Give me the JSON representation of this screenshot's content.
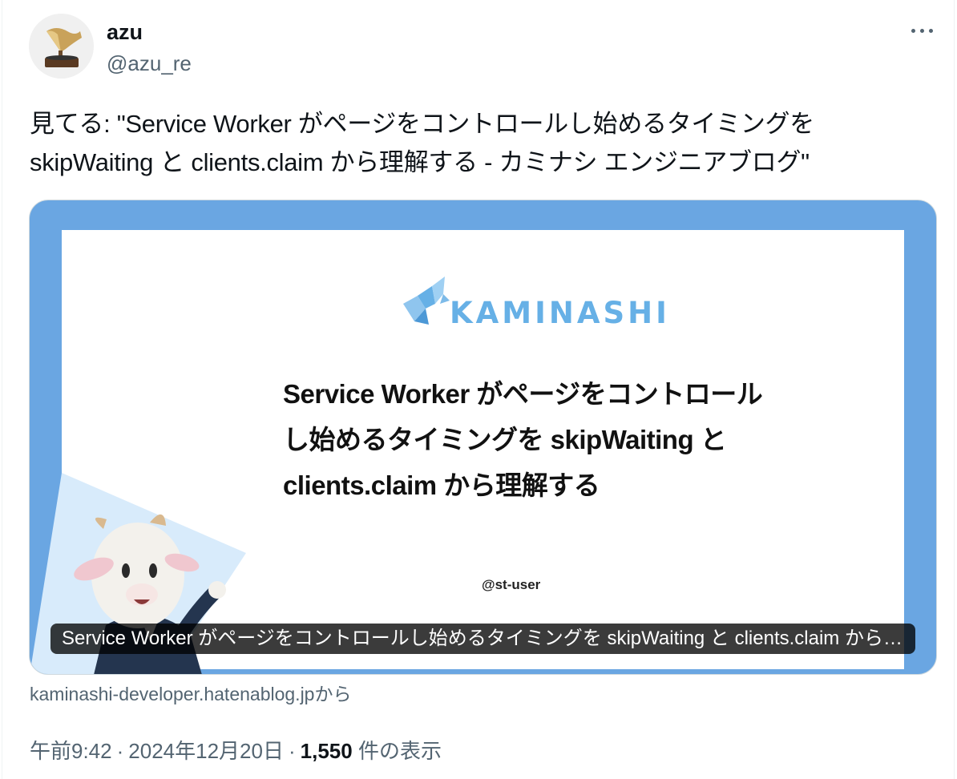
{
  "author": {
    "display_name": "azu",
    "handle": "@azu_re"
  },
  "tweet": {
    "text": "見てる: \"Service Worker がページをコントロールし始めるタイミングを skipWaiting と clients.claim から理解する - カミナシ エンジニアブログ\""
  },
  "card": {
    "logo_text": "KAMINASHI",
    "slide_title": "Service Worker がページをコントロールし始めるタイミングを skipWaiting と clients.claim から理解する",
    "slide_author": "@st-user",
    "caption": "Service Worker がページをコントロールし始めるタイミングを skipWaiting と clients.claim から理解する - カミナシ エンジニアブログ",
    "background_color": "#6aa6e2",
    "source": "kaminashi-developer.hatenablog.jpから"
  },
  "meta": {
    "time": "午前9:42",
    "date": "2024年12月20日",
    "views_count": "1,550",
    "views_label": "件の表示",
    "separator": "·"
  },
  "icons": {
    "avatar": "gramophone-avatar-icon",
    "more": "more-horizontal-icon",
    "logo": "goat-logo-icon",
    "mascot": "goat-mascot-icon"
  }
}
